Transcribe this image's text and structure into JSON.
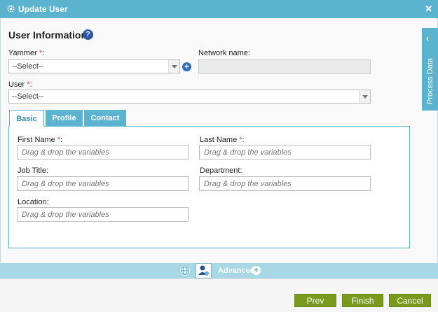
{
  "window": {
    "title": "Update User"
  },
  "section": {
    "title": "User Information"
  },
  "fields": {
    "yammer_label": "Yammer",
    "yammer_value": "--Select--",
    "network_label": "Network name:",
    "user_label": "User",
    "user_value": "--Select--",
    "required_mark": "*",
    "colon": ":"
  },
  "tabs": [
    {
      "label": "Basic",
      "active": true
    },
    {
      "label": "Profile",
      "active": false
    },
    {
      "label": "Contact",
      "active": false
    }
  ],
  "basic": {
    "first_name_label": "First Name",
    "last_name_label": "Last Name",
    "job_title_label": "Job Title:",
    "department_label": "Department:",
    "location_label": "Location:",
    "placeholder": "Drag & drop the variables"
  },
  "sidebar": {
    "label": "Process Data"
  },
  "advanced": {
    "label": "Advanced"
  },
  "footer": {
    "prev": "Prev",
    "finish": "Finish",
    "cancel": "Cancel"
  },
  "colors": {
    "accent": "#5cb3d0",
    "button": "#7a9a1e",
    "help": "#2b56a8"
  },
  "icons": [
    "gear-icon",
    "close-icon",
    "help-icon",
    "add-icon",
    "chevron-left-icon",
    "globe-icon",
    "user-settings-icon",
    "plus-circle-icon",
    "dropdown-arrow-icon"
  ]
}
